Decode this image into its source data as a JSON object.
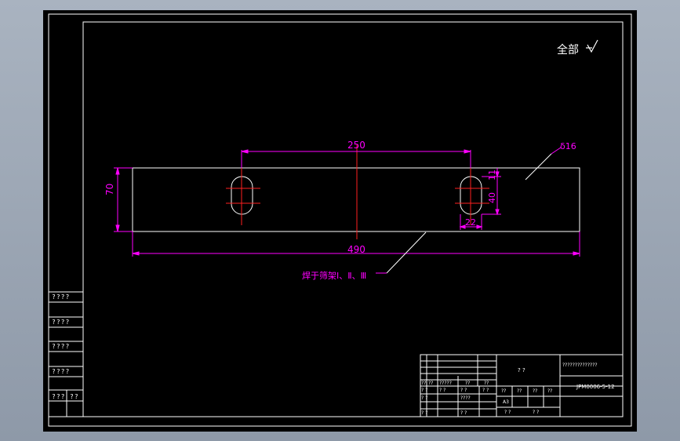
{
  "drawing": {
    "roughness_note": "全部",
    "dimensions": {
      "hole_spacing": "250",
      "total_length": "490",
      "height": "70",
      "slot_offset": "11",
      "slot_height": "40",
      "slot_width": "22"
    },
    "thickness_label": "δ16",
    "weld_note": "焊于筛架Ⅰ、Ⅱ、Ⅲ"
  },
  "side_table": {
    "rows": [
      "????",
      "????",
      "????",
      "????"
    ],
    "bottom_left": "???",
    "bottom_right": "??"
  },
  "title_block": {
    "drawing_title": "??????????????",
    "drawing_number": "JPM0006-5-12",
    "name_placeholder": "?   ?",
    "cells": {
      "r1c1": "??",
      "r1c2": "??",
      "r1c3": "?????",
      "r1c4": "??",
      "r1c5": "??",
      "r2c1": "? ?",
      "r2c2": "? ?",
      "r2c3": "? ?",
      "r2c4": "? ?",
      "r3c1": "? ?",
      "r3c2": "????",
      "r4c1": "? ?",
      "r4c2": "? ?",
      "right1": "??",
      "right2": "??",
      "right3": "??",
      "right4": "??",
      "scale_label": "A3",
      "sheet_left": "?  ?",
      "sheet_right": "?   ?"
    }
  }
}
